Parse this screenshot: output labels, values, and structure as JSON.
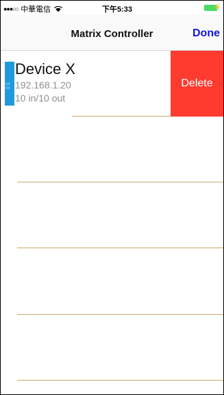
{
  "status_bar": {
    "signal_dots": "●●●○○",
    "carrier": "中華電信",
    "time": "下午5:33",
    "wifi_icon": "wifi-icon",
    "battery_icon": "battery-icon",
    "charge_icon": "⚡"
  },
  "nav": {
    "title": "Matrix Controller",
    "done_label": "Done"
  },
  "device": {
    "name": "Device X",
    "ip": "192.168.1.20",
    "io": "10 in/10 out",
    "accent_color": "#1e9be0"
  },
  "row_action": {
    "delete_label": "Delete",
    "delete_color": "#ff3b30"
  },
  "colors": {
    "tint": "#1414dc",
    "separator": "#c8aa6e"
  }
}
